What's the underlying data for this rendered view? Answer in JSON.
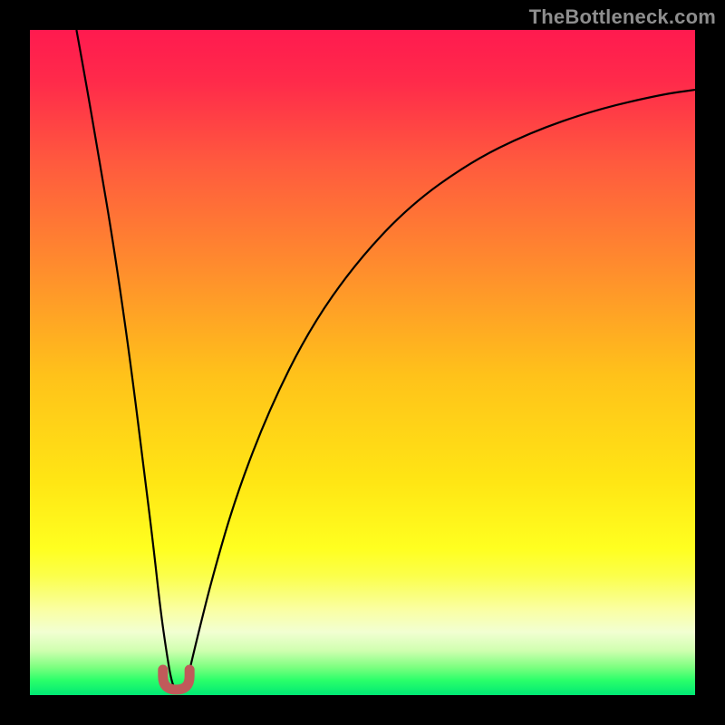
{
  "watermark": "TheBottleneck.com",
  "colors": {
    "frame": "#000000",
    "watermark": "#8e8e8e",
    "curve_stroke": "#000000",
    "notch_stroke": "#c05a5a",
    "gradient_stops": [
      {
        "offset": 0.0,
        "color": "#ff1a4f"
      },
      {
        "offset": 0.08,
        "color": "#ff2b4a"
      },
      {
        "offset": 0.2,
        "color": "#ff5a3e"
      },
      {
        "offset": 0.35,
        "color": "#ff8a2e"
      },
      {
        "offset": 0.52,
        "color": "#ffc21a"
      },
      {
        "offset": 0.68,
        "color": "#ffe614"
      },
      {
        "offset": 0.78,
        "color": "#ffff20"
      },
      {
        "offset": 0.82,
        "color": "#fbff4a"
      },
      {
        "offset": 0.87,
        "color": "#faffa0"
      },
      {
        "offset": 0.905,
        "color": "#f2ffd2"
      },
      {
        "offset": 0.933,
        "color": "#d0ffb0"
      },
      {
        "offset": 0.958,
        "color": "#7dff80"
      },
      {
        "offset": 0.978,
        "color": "#2aff6a"
      },
      {
        "offset": 1.0,
        "color": "#00e874"
      }
    ]
  },
  "chart_data": {
    "type": "line",
    "title": "",
    "xlabel": "",
    "ylabel": "",
    "x_range": [
      0,
      100
    ],
    "y_range": [
      0,
      100
    ],
    "notch_x": 22,
    "notch_width": 4,
    "notch_height": 3,
    "curve_points_percent": [
      {
        "x": 7.0,
        "y": 100.0
      },
      {
        "x": 8.8,
        "y": 90.0
      },
      {
        "x": 10.5,
        "y": 80.0
      },
      {
        "x": 12.2,
        "y": 70.0
      },
      {
        "x": 14.0,
        "y": 58.0
      },
      {
        "x": 15.5,
        "y": 47.0
      },
      {
        "x": 17.0,
        "y": 35.0
      },
      {
        "x": 18.5,
        "y": 23.0
      },
      {
        "x": 19.6,
        "y": 13.0
      },
      {
        "x": 20.6,
        "y": 6.0
      },
      {
        "x": 21.3,
        "y": 2.0
      },
      {
        "x": 22.0,
        "y": 0.5
      },
      {
        "x": 22.8,
        "y": 0.5
      },
      {
        "x": 23.6,
        "y": 2.0
      },
      {
        "x": 25.0,
        "y": 8.0
      },
      {
        "x": 27.5,
        "y": 18.0
      },
      {
        "x": 31.0,
        "y": 30.0
      },
      {
        "x": 36.0,
        "y": 43.0
      },
      {
        "x": 42.0,
        "y": 55.0
      },
      {
        "x": 49.0,
        "y": 65.0
      },
      {
        "x": 57.0,
        "y": 73.5
      },
      {
        "x": 66.0,
        "y": 80.0
      },
      {
        "x": 75.0,
        "y": 84.5
      },
      {
        "x": 85.0,
        "y": 88.0
      },
      {
        "x": 95.0,
        "y": 90.3
      },
      {
        "x": 100.0,
        "y": 91.0
      }
    ]
  }
}
